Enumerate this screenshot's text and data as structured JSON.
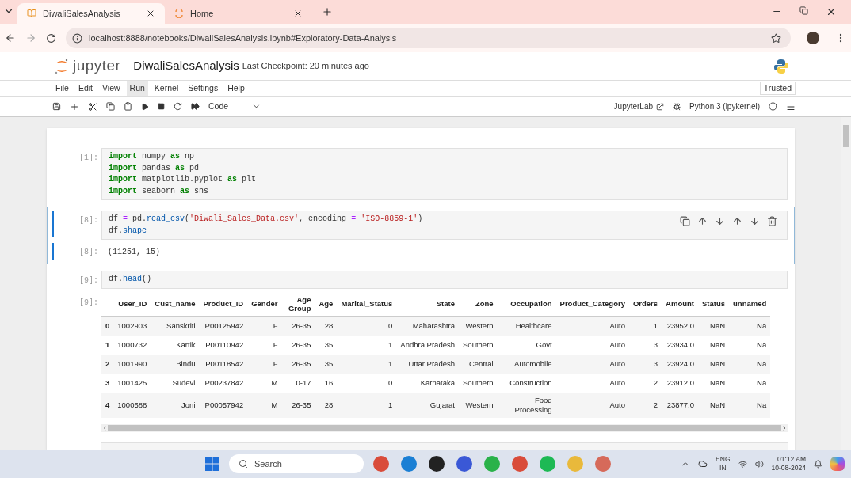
{
  "browser": {
    "tabs": [
      {
        "title": "DiwaliSalesAnalysis",
        "selected": true
      },
      {
        "title": "Home",
        "selected": false
      }
    ],
    "url": "localhost:8888/notebooks/DiwaliSalesAnalysis.ipynb#Exploratory-Data-Analysis"
  },
  "jupyter": {
    "logo_text": "jupyter",
    "notebook_name": "DiwaliSalesAnalysis",
    "checkpoint": "Last Checkpoint: 20 minutes ago",
    "trusted": "Trusted",
    "menu": [
      {
        "label": "File",
        "selected": false
      },
      {
        "label": "Edit",
        "selected": false
      },
      {
        "label": "View",
        "selected": false
      },
      {
        "label": "Run",
        "selected": true
      },
      {
        "label": "Kernel",
        "selected": false
      },
      {
        "label": "Settings",
        "selected": false
      },
      {
        "label": "Help",
        "selected": false
      }
    ],
    "cell_type": "Code",
    "jupyterlab_link": "JupyterLab",
    "kernel": "Python 3 (ipykernel)"
  },
  "cells": [
    {
      "prompt": "[1]:",
      "active": false,
      "lines": [
        [
          {
            "t": "import",
            "kind": "keyword"
          },
          {
            "t": " numpy ",
            "kind": "name"
          },
          {
            "t": "as",
            "kind": "keyword"
          },
          {
            "t": " np",
            "kind": "name"
          }
        ],
        [
          {
            "t": "import",
            "kind": "keyword"
          },
          {
            "t": " pandas ",
            "kind": "name"
          },
          {
            "t": "as",
            "kind": "keyword"
          },
          {
            "t": " pd",
            "kind": "name"
          }
        ],
        [
          {
            "t": "import",
            "kind": "keyword"
          },
          {
            "t": " matplotlib.pyplot ",
            "kind": "name"
          },
          {
            "t": "as",
            "kind": "keyword"
          },
          {
            "t": " plt",
            "kind": "name"
          }
        ],
        [
          {
            "t": "import",
            "kind": "keyword"
          },
          {
            "t": " seaborn ",
            "kind": "name"
          },
          {
            "t": "as",
            "kind": "keyword"
          },
          {
            "t": " sns",
            "kind": "name"
          }
        ]
      ]
    },
    {
      "prompt": "[8]:",
      "active": true,
      "lines": [
        [
          {
            "t": "df ",
            "kind": "name"
          },
          {
            "t": "=",
            "kind": "operator"
          },
          {
            "t": " pd.",
            "kind": "name"
          },
          {
            "t": "read_csv",
            "kind": "attribute"
          },
          {
            "t": "(",
            "kind": "name"
          },
          {
            "t": "'Diwali_Sales_Data.csv'",
            "kind": "string"
          },
          {
            "t": ", encoding ",
            "kind": "name"
          },
          {
            "t": "=",
            "kind": "operator"
          },
          {
            "t": " 'ISO-8859-1'",
            "kind": "string"
          },
          {
            "t": ")",
            "kind": "name"
          }
        ],
        [
          {
            "t": "df.",
            "kind": "name"
          },
          {
            "t": "shape",
            "kind": "attribute"
          }
        ]
      ],
      "output_prompt": "[8]:",
      "output": "(11251, 15)"
    },
    {
      "prompt": "[9]:",
      "active": false,
      "lines": [
        [
          {
            "t": "df.",
            "kind": "name"
          },
          {
            "t": "head",
            "kind": "attribute"
          },
          {
            "t": "()",
            "kind": "name"
          }
        ]
      ],
      "output_prompt": "[9]:"
    }
  ],
  "table": {
    "columns": [
      "",
      "User_ID",
      "Cust_name",
      "Product_ID",
      "Gender",
      "Age Group",
      "Age",
      "Marital_Status",
      "State",
      "Zone",
      "Occupation",
      "Product_Category",
      "Orders",
      "Amount",
      "Status",
      "unnamed"
    ],
    "rows": [
      [
        "0",
        "1002903",
        "Sanskriti",
        "P00125942",
        "F",
        "26-35",
        "28",
        "0",
        "Maharashtra",
        "Western",
        "Healthcare",
        "Auto",
        "1",
        "23952.0",
        "NaN",
        "Na"
      ],
      [
        "1",
        "1000732",
        "Kartik",
        "P00110942",
        "F",
        "26-35",
        "35",
        "1",
        "Andhra Pradesh",
        "Southern",
        "Govt",
        "Auto",
        "3",
        "23934.0",
        "NaN",
        "Na"
      ],
      [
        "2",
        "1001990",
        "Bindu",
        "P00118542",
        "F",
        "26-35",
        "35",
        "1",
        "Uttar Pradesh",
        "Central",
        "Automobile",
        "Auto",
        "3",
        "23924.0",
        "NaN",
        "Na"
      ],
      [
        "3",
        "1001425",
        "Sudevi",
        "P00237842",
        "M",
        "0-17",
        "16",
        "0",
        "Karnataka",
        "Southern",
        "Construction",
        "Auto",
        "2",
        "23912.0",
        "NaN",
        "Na"
      ],
      [
        "4",
        "1000588",
        "Joni",
        "P00057942",
        "M",
        "26-35",
        "28",
        "1",
        "Gujarat",
        "Western",
        "Food Processing",
        "Auto",
        "2",
        "23877.0",
        "NaN",
        "Na"
      ]
    ]
  },
  "taskbar": {
    "search_placeholder": "Search",
    "language": "ENG",
    "region": "IN",
    "time": "01:12 AM",
    "date": "10-08-2024"
  }
}
